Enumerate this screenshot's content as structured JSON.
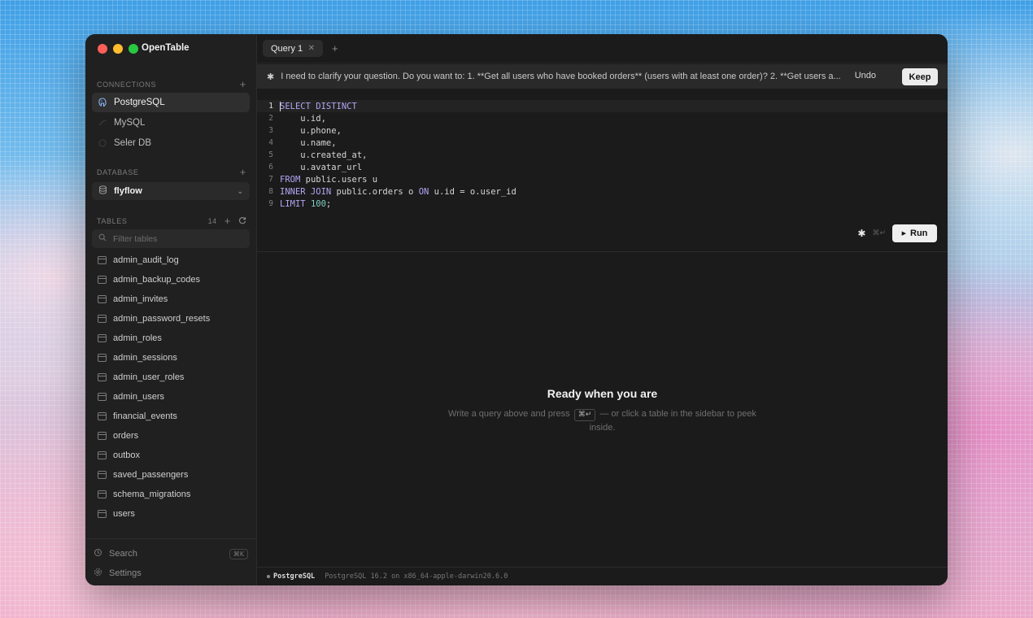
{
  "app": {
    "name": "OpenTable"
  },
  "sidebar": {
    "connections_header": "CONNECTIONS",
    "connections": [
      {
        "label": "PostgreSQL",
        "icon": "postgres-icon",
        "active": true
      },
      {
        "label": "MySQL",
        "icon": "mysql-icon",
        "active": false
      },
      {
        "label": "Seler DB",
        "icon": "database-icon",
        "active": false
      }
    ],
    "database_header": "DATABASE",
    "database_selected": "flyflow",
    "tables_header": "TABLES",
    "tables_count": "14",
    "filter_placeholder": "Filter tables",
    "tables": [
      "admin_audit_log",
      "admin_backup_codes",
      "admin_invites",
      "admin_password_resets",
      "admin_roles",
      "admin_sessions",
      "admin_user_roles",
      "admin_users",
      "financial_events",
      "orders",
      "outbox",
      "saved_passengers",
      "schema_migrations",
      "users"
    ],
    "footer": {
      "search_label": "Search",
      "search_shortcut": "⌘K",
      "settings_label": "Settings"
    }
  },
  "tabs": [
    {
      "label": "Query 1"
    }
  ],
  "suggestion": {
    "message": "I need to clarify your question. Do you want to: 1. **Get all users who have booked orders** (users with at least one order)? 2. **Get users a...",
    "undo_label": "Undo",
    "keep_label": "Keep"
  },
  "editor": {
    "line_numbers": [
      "1",
      "2",
      "3",
      "4",
      "5",
      "6",
      "7",
      "8",
      "9"
    ]
  },
  "run": {
    "shortcut_hint": "⌘↵",
    "button_label": "Run"
  },
  "empty_state": {
    "title": "Ready when you are",
    "text_before": "Write a query above and press",
    "kbd": "⌘↵",
    "text_after": "— or click a table in the sidebar to peek inside."
  },
  "status": {
    "engine": "PostgreSQL",
    "version": "PostgreSQL 16.2 on x86_64-apple-darwin20.6.0"
  },
  "colors": {
    "keyword": "#b3a6f5",
    "number": "#7fcfbf",
    "accent_button": "#efefef"
  }
}
